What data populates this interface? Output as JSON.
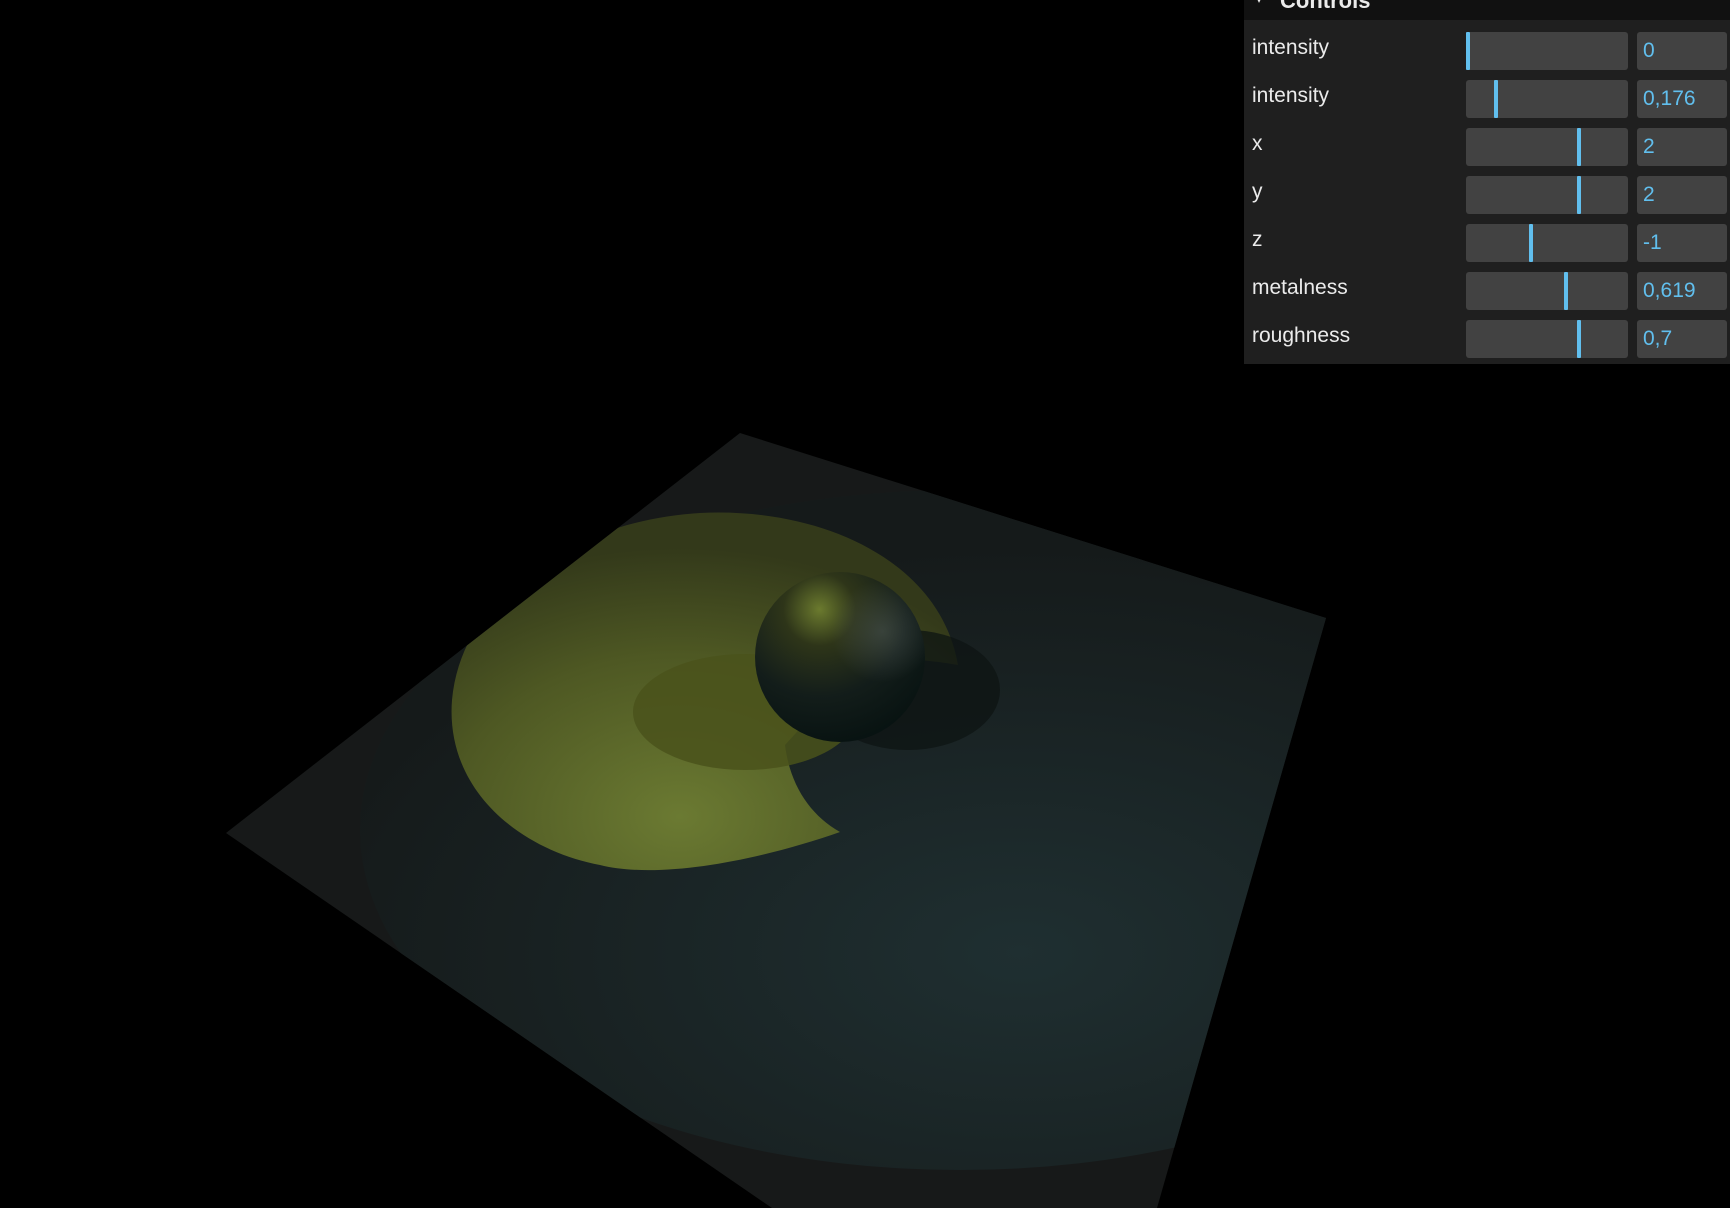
{
  "gui": {
    "title": "Controls",
    "controls": [
      {
        "label": "intensity",
        "value": "0",
        "fraction": 0.0
      },
      {
        "label": "intensity",
        "value": "0,176",
        "fraction": 0.176
      },
      {
        "label": "x",
        "value": "2",
        "fraction": 0.7
      },
      {
        "label": "y",
        "value": "2",
        "fraction": 0.7
      },
      {
        "label": "z",
        "value": "-1",
        "fraction": 0.4
      },
      {
        "label": "metalness",
        "value": "0,619",
        "fraction": 0.619
      },
      {
        "label": "roughness",
        "value": "0,7",
        "fraction": 0.7
      }
    ]
  },
  "colors": {
    "accent": "#61bfee",
    "panel_bg": "#1f1f1f",
    "control_bg": "#424242",
    "canvas_bg": "#000000"
  }
}
